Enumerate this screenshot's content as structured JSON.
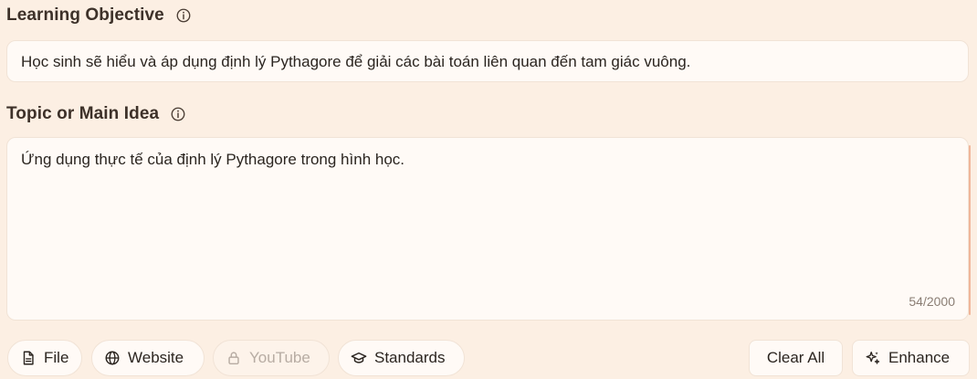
{
  "learning_objective": {
    "label": "Learning Objective",
    "value": "Học sinh sẽ hiểu và áp dụng định lý Pythagore để giải các bài toán liên quan đến tam giác vuông."
  },
  "topic": {
    "label": "Topic or Main Idea",
    "value": "Ứng dụng thực tế của định lý Pythagore trong hình học.",
    "counter": "54/2000"
  },
  "toolbar": {
    "file_label": "File",
    "website_label": "Website",
    "youtube_label": "YouTube",
    "standards_label": "Standards",
    "clear_all_label": "Clear All",
    "enhance_label": "Enhance"
  },
  "icons": {
    "info": "info-icon",
    "file": "file-icon",
    "website": "globe-icon",
    "youtube": "lock-icon",
    "standards": "graduation-cap-icon",
    "enhance": "sparkles-icon"
  },
  "colors": {
    "background": "#fcefe3",
    "field_bg": "#fffaf6",
    "accent_scroll": "#f0b69a",
    "disabled_text": "#b7aca3"
  }
}
